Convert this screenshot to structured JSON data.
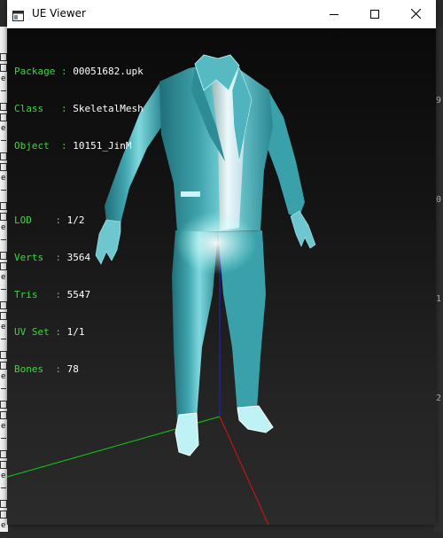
{
  "window": {
    "title": "UE Viewer",
    "icon": "app-window-icon",
    "controls": [
      "minimize-icon",
      "maximize-icon",
      "close-icon"
    ]
  },
  "info": {
    "package": {
      "label": "Package",
      "value": "00051682.upk"
    },
    "class": {
      "label": "Class",
      "value": "SkeletalMesh"
    },
    "object": {
      "label": "Object",
      "value": "10151_JinM"
    },
    "lod": {
      "label": "LOD",
      "value": "1/2"
    },
    "verts": {
      "label": "Verts",
      "value": "3564"
    },
    "tris": {
      "label": "Tris",
      "value": "5547"
    },
    "uvset": {
      "label": "UV Set",
      "value": "1/1"
    },
    "bones": {
      "label": "Bones",
      "value": "78"
    }
  },
  "colors": {
    "label_green": "#3fd63f",
    "value_white": "#ffffff",
    "mesh_teal": "#3fa3ad",
    "axis_x": "#e01010",
    "axis_y": "#10d010",
    "axis_z": "#2020e0"
  },
  "background": {
    "right_ruler_labels": [
      "9",
      "0",
      "1",
      "2"
    ],
    "left_strip_letter": "e"
  }
}
